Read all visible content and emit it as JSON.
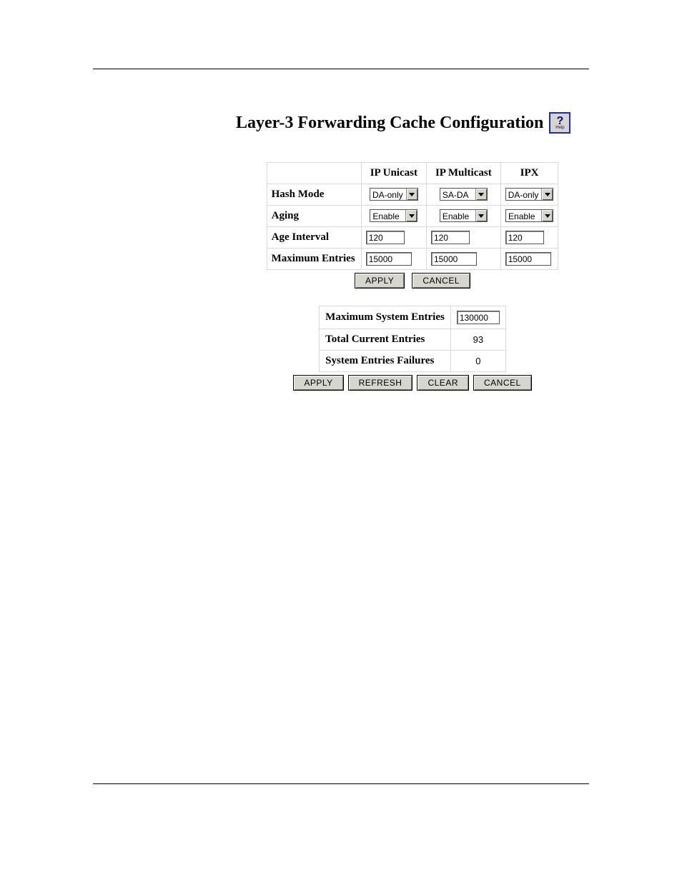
{
  "title": "Layer-3 Forwarding Cache Configuration",
  "help_label": "Help",
  "columns": {
    "empty": "",
    "ip_unicast": "IP Unicast",
    "ip_multicast": "IP Multicast",
    "ipx": "IPX"
  },
  "rows": {
    "hash_mode": {
      "label": "Hash Mode",
      "ip_unicast": "DA-only",
      "ip_multicast": "SA-DA",
      "ipx": "DA-only"
    },
    "aging": {
      "label": "Aging",
      "ip_unicast": "Enable",
      "ip_multicast": "Enable",
      "ipx": "Enable"
    },
    "age_interval": {
      "label": "Age Interval",
      "ip_unicast": "120",
      "ip_multicast": "120",
      "ipx": "120"
    },
    "maximum_entries": {
      "label": "Maximum Entries",
      "ip_unicast": "15000",
      "ip_multicast": "15000",
      "ipx": "15000"
    }
  },
  "table1_buttons": {
    "apply": "APPLY",
    "cancel": "CANCEL"
  },
  "stats": {
    "max_system_entries": {
      "label": "Maximum System Entries",
      "value": "130000"
    },
    "total_current_entries": {
      "label": "Total Current Entries",
      "value": "93"
    },
    "system_entries_failures": {
      "label": "System Entries Failures",
      "value": "0"
    }
  },
  "table2_buttons": {
    "apply": "APPLY",
    "refresh": "REFRESH",
    "clear": "CLEAR",
    "cancel": "CANCEL"
  }
}
